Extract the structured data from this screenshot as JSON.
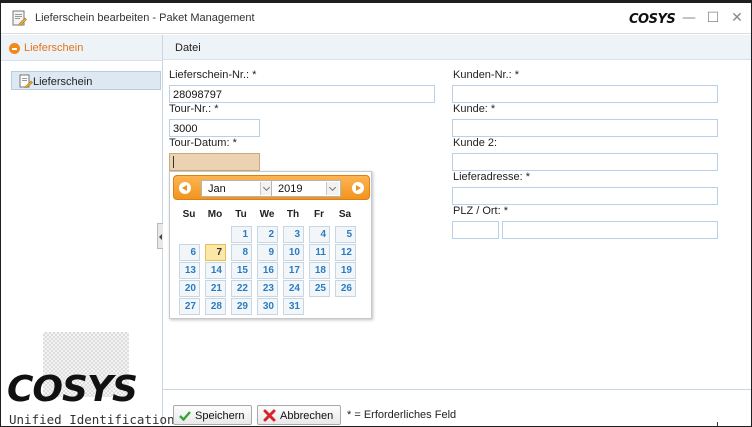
{
  "window": {
    "title": "Lieferschein bearbeiten - Paket Management",
    "brand": "COSYS",
    "minimize_glyph": "—",
    "maximize_glyph": "☐",
    "close_glyph": "✕"
  },
  "sidebar": {
    "header_label": "Lieferschein",
    "items": [
      {
        "label": "Lieferschein",
        "icon": "document-edit-icon"
      }
    ],
    "logo_text": "COSYS",
    "logo_subtitle": "Unified Identification"
  },
  "menu": {
    "file_label": "Datei"
  },
  "form": {
    "lieferschein_nr_label": "Lieferschein-Nr.: *",
    "lieferschein_nr_value": "28098797",
    "tour_nr_label": "Tour-Nr.: *",
    "tour_nr_value": "3000",
    "tour_datum_label": "Tour-Datum: *",
    "tour_datum_value": "",
    "kunden_nr_label": "Kunden-Nr.: *",
    "kunden_nr_value": "",
    "kunde_label": "Kunde: *",
    "kunde_value": "",
    "kunde2_label": "Kunde 2:",
    "kunde2_value": "",
    "lieferadresse_label": "Lieferadresse: *",
    "lieferadresse_value": "",
    "plz_ort_label": "PLZ / Ort: *",
    "plz_value": "",
    "ort_value": ""
  },
  "datepicker": {
    "month": "Jan",
    "year": "2019",
    "weekdays": [
      "Su",
      "Mo",
      "Tu",
      "We",
      "Th",
      "Fr",
      "Sa"
    ],
    "weeks": [
      [
        "",
        "",
        "1",
        "2",
        "3",
        "4",
        "5"
      ],
      [
        "6",
        "7",
        "8",
        "9",
        "10",
        "11",
        "12"
      ],
      [
        "13",
        "14",
        "15",
        "16",
        "17",
        "18",
        "19"
      ],
      [
        "20",
        "21",
        "22",
        "23",
        "24",
        "25",
        "26"
      ],
      [
        "27",
        "28",
        "29",
        "30",
        "31",
        "",
        ""
      ]
    ],
    "today": "7",
    "accent_color": "#f2941f",
    "day_color": "#2a7cc2"
  },
  "footer": {
    "save_label": "Speichern",
    "cancel_label": "Abbrechen",
    "required_note": "* = Erforderliches Feld"
  },
  "colors": {
    "accent": "#f08a1c",
    "field_border": "#b8d1e8",
    "date_field_bg": "#ebd3b2",
    "toolbar_bg": "#eef3f8"
  }
}
